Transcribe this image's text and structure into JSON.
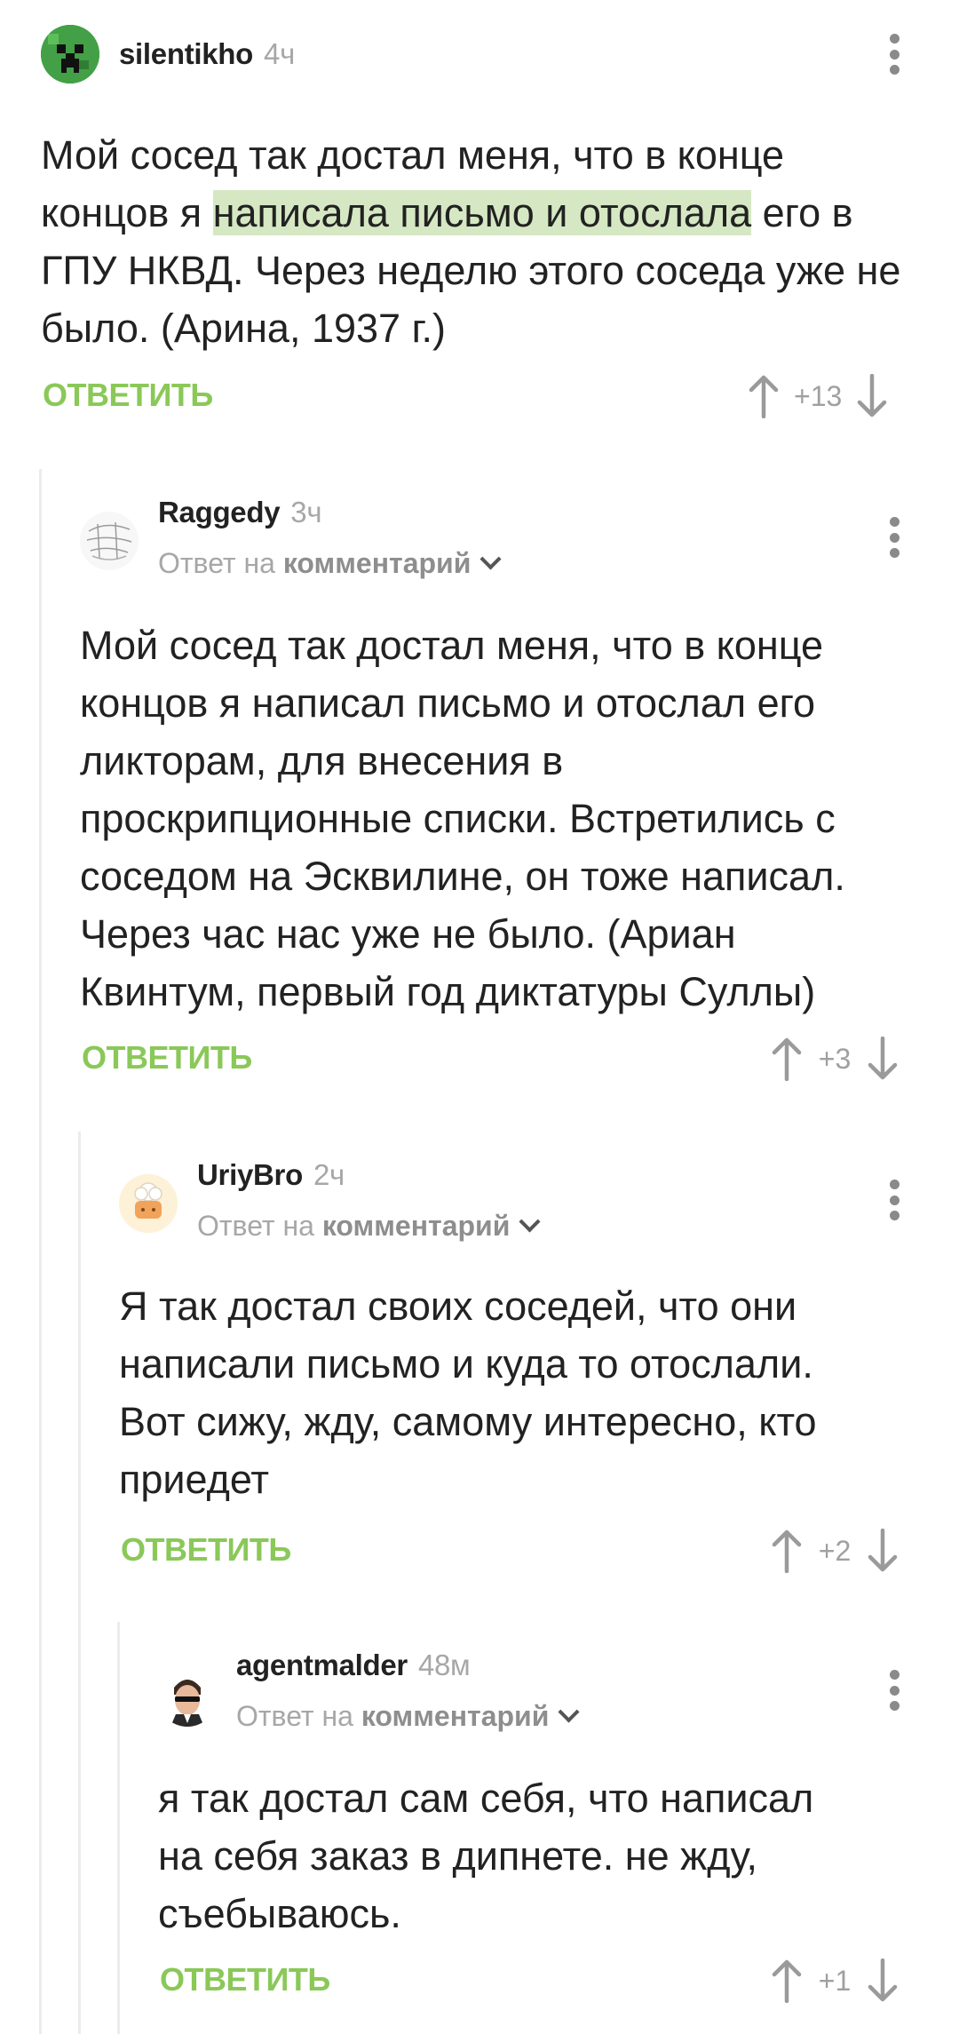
{
  "common": {
    "reply_label": "ОТВЕТИТЬ",
    "reply_to_prefix": "Ответ на",
    "reply_to_link": "комментарий"
  },
  "comments": [
    {
      "user": "silentikho",
      "time": "4ч",
      "text_before": "Мой сосед так достал меня, что в конце концов я ",
      "text_highlight": "написала письмо и отослала",
      "text_after": " его в ГПУ НКВД. Через неделю этого соседа уже не было. (Арина, 1937 г.)",
      "score": "+13"
    },
    {
      "user": "Raggedy",
      "time": "3ч",
      "text": "Мой сосед так достал меня, что в конце концов я написал письмо и отослал его ликторам, для внесения в проскрипционные списки. Встретились с соседом на Эсквилине, он тоже написал. Через час нас уже не было. (Ариан Квинтум, первый год диктатуры Суллы)",
      "score": "+3"
    },
    {
      "user": "UriyBro",
      "time": "2ч",
      "text": "Я так достал своих соседей, что они написали письмо и куда то отослали. Вот сижу, жду, самому интересно, кто приедет",
      "score": "+2"
    },
    {
      "user": "agentmalder",
      "time": "48м",
      "text": "я так достал сам себя, что написал на себя заказ в дипнете. не жду, съебываюсь.",
      "score": "+1"
    }
  ],
  "colors": {
    "accent_green": "#8ac858",
    "highlight": "#d5e8c3",
    "muted": "#a7a7a7",
    "thread_line": "#ececec"
  }
}
